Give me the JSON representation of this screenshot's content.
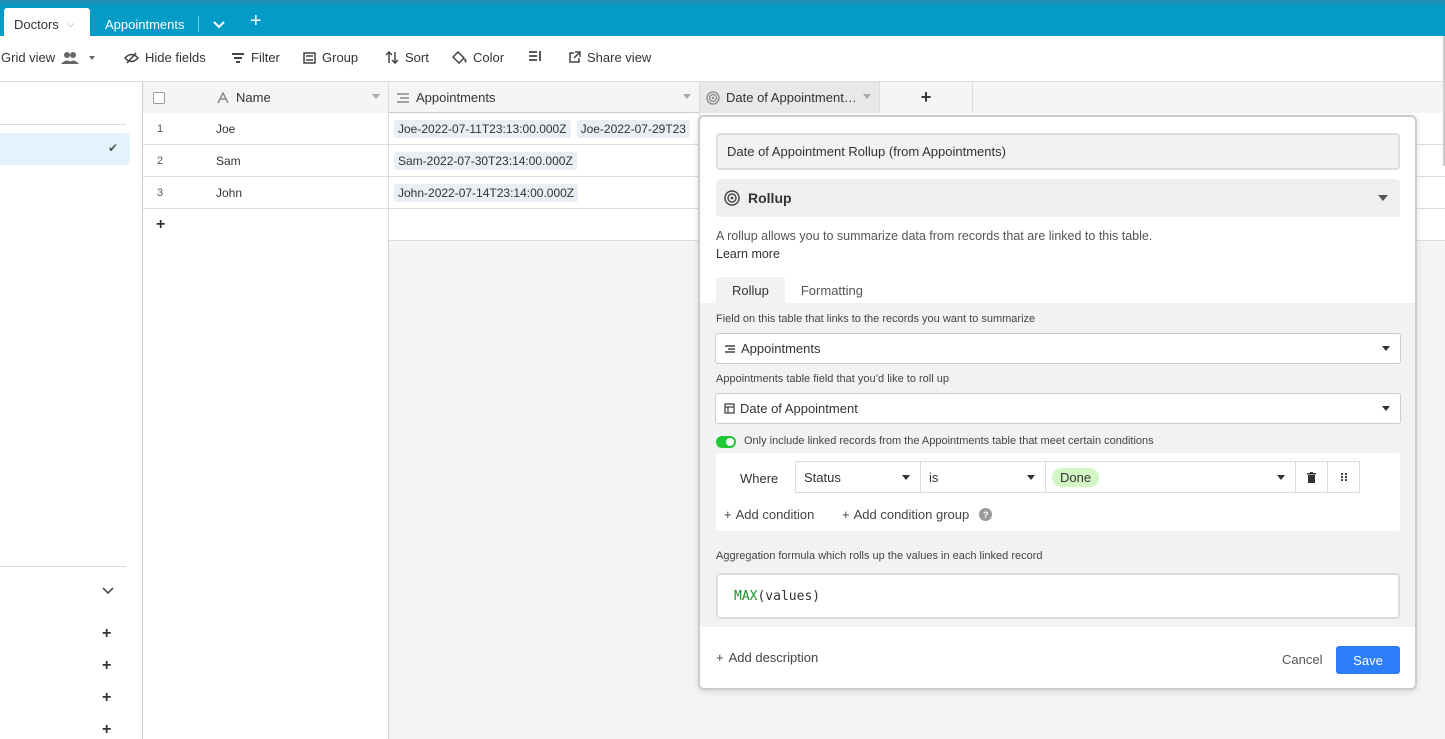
{
  "tabs": {
    "active": "Doctors",
    "other": "Appointments",
    "add": "+"
  },
  "toolbar": {
    "view": "Grid view",
    "hide_fields": "Hide fields",
    "filter": "Filter",
    "group": "Group",
    "sort": "Sort",
    "color": "Color",
    "share_view": "Share view"
  },
  "grid": {
    "columns": [
      {
        "label": "Name",
        "icon": "text-a-icon"
      },
      {
        "label": "Appointments",
        "icon": "link-records-icon"
      },
      {
        "label": "Date of Appointment…",
        "icon": "rollup-icon"
      }
    ],
    "add_column": "+",
    "rows": [
      {
        "num": "1",
        "name": "Joe",
        "appointments": [
          "Joe-2022-07-11T23:13:00.000Z",
          "Joe-2022-07-29T23"
        ]
      },
      {
        "num": "2",
        "name": "Sam",
        "appointments": [
          "Sam-2022-07-30T23:14:00.000Z"
        ]
      },
      {
        "num": "3",
        "name": "John",
        "appointments": [
          "John-2022-07-14T23:14:00.000Z"
        ]
      }
    ],
    "add_row": "+"
  },
  "popover": {
    "field_name": "Date of Appointment Rollup (from Appointments)",
    "field_type": "Rollup",
    "description": "A rollup allows you to summarize data from records that are linked to this table.",
    "learn_more": "Learn more",
    "tabs": [
      "Rollup",
      "Formatting"
    ],
    "link_label": "Field on this table that links to the records you want to summarize",
    "link_value": "Appointments",
    "rollup_label": "Appointments table field that you’d like to roll up",
    "rollup_value": "Date of Appointment",
    "condition_toggle_label": "Only include linked records from the Appointments table that meet certain conditions",
    "condition": {
      "where": "Where",
      "field": "Status",
      "operator": "is",
      "value": "Done"
    },
    "add_condition": "Add condition",
    "add_condition_group": "Add condition group",
    "aggregation_label": "Aggregation formula which rolls up the values in each linked record",
    "formula_fn": "MAX",
    "formula_args": "(values)",
    "add_description": "Add description",
    "cancel": "Cancel",
    "save": "Save"
  },
  "colors": {
    "tabbar": "#039cc7",
    "save_button": "#2d7ff9",
    "toggle_on": "#20c933",
    "done_pill": "#d1f7c4"
  }
}
